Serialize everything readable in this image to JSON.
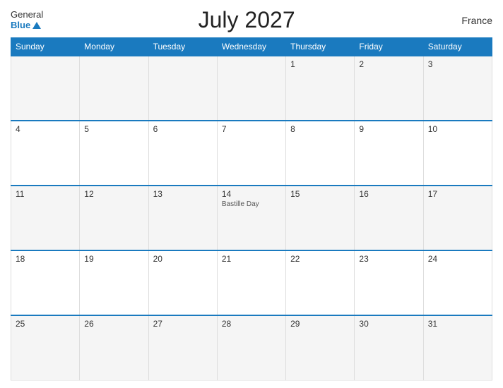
{
  "header": {
    "logo_general": "General",
    "logo_blue": "Blue",
    "title": "July 2027",
    "country": "France"
  },
  "calendar": {
    "days_of_week": [
      "Sunday",
      "Monday",
      "Tuesday",
      "Wednesday",
      "Thursday",
      "Friday",
      "Saturday"
    ],
    "weeks": [
      [
        {
          "day": "",
          "event": ""
        },
        {
          "day": "",
          "event": ""
        },
        {
          "day": "",
          "event": ""
        },
        {
          "day": "",
          "event": ""
        },
        {
          "day": "1",
          "event": ""
        },
        {
          "day": "2",
          "event": ""
        },
        {
          "day": "3",
          "event": ""
        }
      ],
      [
        {
          "day": "4",
          "event": ""
        },
        {
          "day": "5",
          "event": ""
        },
        {
          "day": "6",
          "event": ""
        },
        {
          "day": "7",
          "event": ""
        },
        {
          "day": "8",
          "event": ""
        },
        {
          "day": "9",
          "event": ""
        },
        {
          "day": "10",
          "event": ""
        }
      ],
      [
        {
          "day": "11",
          "event": ""
        },
        {
          "day": "12",
          "event": ""
        },
        {
          "day": "13",
          "event": ""
        },
        {
          "day": "14",
          "event": "Bastille Day"
        },
        {
          "day": "15",
          "event": ""
        },
        {
          "day": "16",
          "event": ""
        },
        {
          "day": "17",
          "event": ""
        }
      ],
      [
        {
          "day": "18",
          "event": ""
        },
        {
          "day": "19",
          "event": ""
        },
        {
          "day": "20",
          "event": ""
        },
        {
          "day": "21",
          "event": ""
        },
        {
          "day": "22",
          "event": ""
        },
        {
          "day": "23",
          "event": ""
        },
        {
          "day": "24",
          "event": ""
        }
      ],
      [
        {
          "day": "25",
          "event": ""
        },
        {
          "day": "26",
          "event": ""
        },
        {
          "day": "27",
          "event": ""
        },
        {
          "day": "28",
          "event": ""
        },
        {
          "day": "29",
          "event": ""
        },
        {
          "day": "30",
          "event": ""
        },
        {
          "day": "31",
          "event": ""
        }
      ]
    ]
  }
}
